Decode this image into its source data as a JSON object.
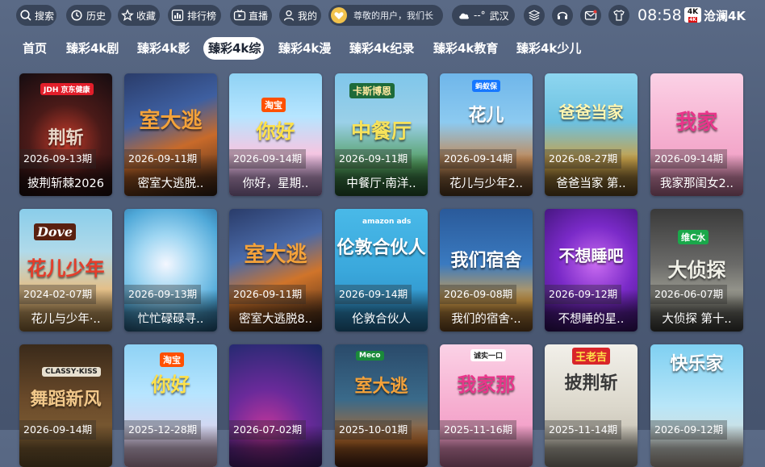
{
  "topbar": {
    "search_label": "搜索",
    "history_label": "历史",
    "favorites_label": "收藏",
    "ranking_label": "排行榜",
    "live_label": "直播",
    "mine_label": "我的",
    "user_greeting": "尊敬的用户，我们长",
    "weather_temp": "--°",
    "weather_city": "武汉",
    "clock": "08:58",
    "brand_badge_top": "4K",
    "brand_badge_bottom": "4K",
    "brand_name": "沧澜4K",
    "accent_user_icon": "#f2c24b"
  },
  "tabs": [
    {
      "label": "首页"
    },
    {
      "label": "臻彩4k剧"
    },
    {
      "label": "臻彩4k影"
    },
    {
      "label": "臻彩4k综",
      "active": true
    },
    {
      "label": "臻彩4k漫"
    },
    {
      "label": "臻彩4k纪录"
    },
    {
      "label": "臻彩4k教育"
    },
    {
      "label": "臻彩4k少儿"
    }
  ],
  "cards": [
    {
      "period": "2026-09-13期",
      "title": "披荆斩棘2026",
      "logo": "JDH 京东健康",
      "poster_text": "荆斩"
    },
    {
      "period": "2026-09-11期",
      "title": "密室大逃脱..",
      "logo": "",
      "poster_text": "室大逃"
    },
    {
      "period": "2026-09-14期",
      "title": "你好，星期..",
      "logo": "淘宝",
      "poster_text": "你好"
    },
    {
      "period": "2026-09-11期",
      "title": "中餐厅·南洋..",
      "logo": "卡斯博恩",
      "poster_text": "中餐厅"
    },
    {
      "period": "2026-09-14期",
      "title": "花儿与少年2..",
      "logo": "蚂蚁保",
      "poster_text": "花儿"
    },
    {
      "period": "2026-08-27期",
      "title": "爸爸当家 第..",
      "logo": "",
      "poster_text": "爸爸当家"
    },
    {
      "period": "2026-09-14期",
      "title": "我家那闺女2..",
      "logo": "",
      "poster_text": "我家"
    },
    {
      "period": "2024-02-07期",
      "title": "花儿与少年·..",
      "logo": "Dove",
      "poster_text": "花儿少年"
    },
    {
      "period": "2026-09-13期",
      "title": "忙忙碌碌寻..",
      "logo": "",
      "poster_text": ""
    },
    {
      "period": "2026-09-11期",
      "title": "密室大逃脱8..",
      "logo": "",
      "poster_text": "室大逃"
    },
    {
      "period": "2026-09-14期",
      "title": "伦敦合伙人",
      "logo": "amazon ads",
      "poster_text": "伦敦合伙人"
    },
    {
      "period": "2026-09-08期",
      "title": "我们的宿舍·..",
      "logo": "",
      "poster_text": "我们宿舍"
    },
    {
      "period": "2026-09-12期",
      "title": "不想睡的星..",
      "logo": "",
      "poster_text": "不想睡吧"
    },
    {
      "period": "2026-06-07期",
      "title": "大侦探 第十..",
      "logo": "维C水",
      "poster_text": "大侦探"
    },
    {
      "period": "2026-09-14期",
      "title": "",
      "logo": "CLASSY·KISS",
      "poster_text": "舞蹈新风"
    },
    {
      "period": "2025-12-28期",
      "title": "",
      "logo": "淘宝",
      "poster_text": "你好"
    },
    {
      "period": "2026-07-02期",
      "title": "",
      "logo": "",
      "poster_text": ""
    },
    {
      "period": "2025-10-01期",
      "title": "",
      "logo": "Meco",
      "poster_text": "室大逃"
    },
    {
      "period": "2025-11-16期",
      "title": "",
      "logo": "诚实一口",
      "poster_text": "我家那"
    },
    {
      "period": "2025-11-14期",
      "title": "",
      "logo": "王老吉",
      "poster_text": "披荆斩"
    },
    {
      "period": "2026-09-12期",
      "title": "",
      "logo": "",
      "poster_text": "快乐家"
    }
  ]
}
